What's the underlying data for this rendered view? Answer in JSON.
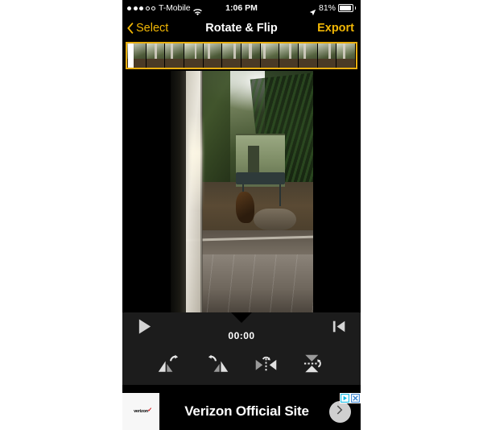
{
  "app": {
    "screen_background": "#000000",
    "accent_color": "#f2b705",
    "page_background": "#ffffff"
  },
  "status_bar": {
    "signal_dots_filled": 3,
    "signal_dots_total": 5,
    "carrier": "T-Mobile",
    "wifi_icon": "wifi-icon",
    "time": "1:06 PM",
    "location_icon": "location-arrow-icon",
    "battery_percent": "81%",
    "battery_icon": "battery-icon"
  },
  "nav_bar": {
    "back_icon": "chevron-left-icon",
    "back_label": "Select",
    "title": "Rotate & Flip",
    "export_label": "Export"
  },
  "filmstrip": {
    "border_color": "#e8ae10",
    "frame_count": 12,
    "playhead_name": "playhead-handle"
  },
  "player": {
    "play_icon": "play-icon",
    "timecode": "00:00",
    "skip_to_start_icon": "skip-to-start-icon",
    "playhead_marker_icon": "playhead-marker-icon"
  },
  "tools": [
    {
      "id": "rotate-left",
      "icon": "rotate-counterclockwise-icon"
    },
    {
      "id": "rotate-right",
      "icon": "rotate-clockwise-icon"
    },
    {
      "id": "flip-horizontal",
      "icon": "flip-horizontal-icon"
    },
    {
      "id": "flip-vertical",
      "icon": "flip-vertical-icon"
    }
  ],
  "ad": {
    "logo_text": "verizon",
    "logo_check": "✓",
    "title": "Verizon Official Site",
    "cta_icon": "chevron-right-icon",
    "adchoices_icon": "adchoices-icon",
    "close_icon": "close-icon"
  }
}
